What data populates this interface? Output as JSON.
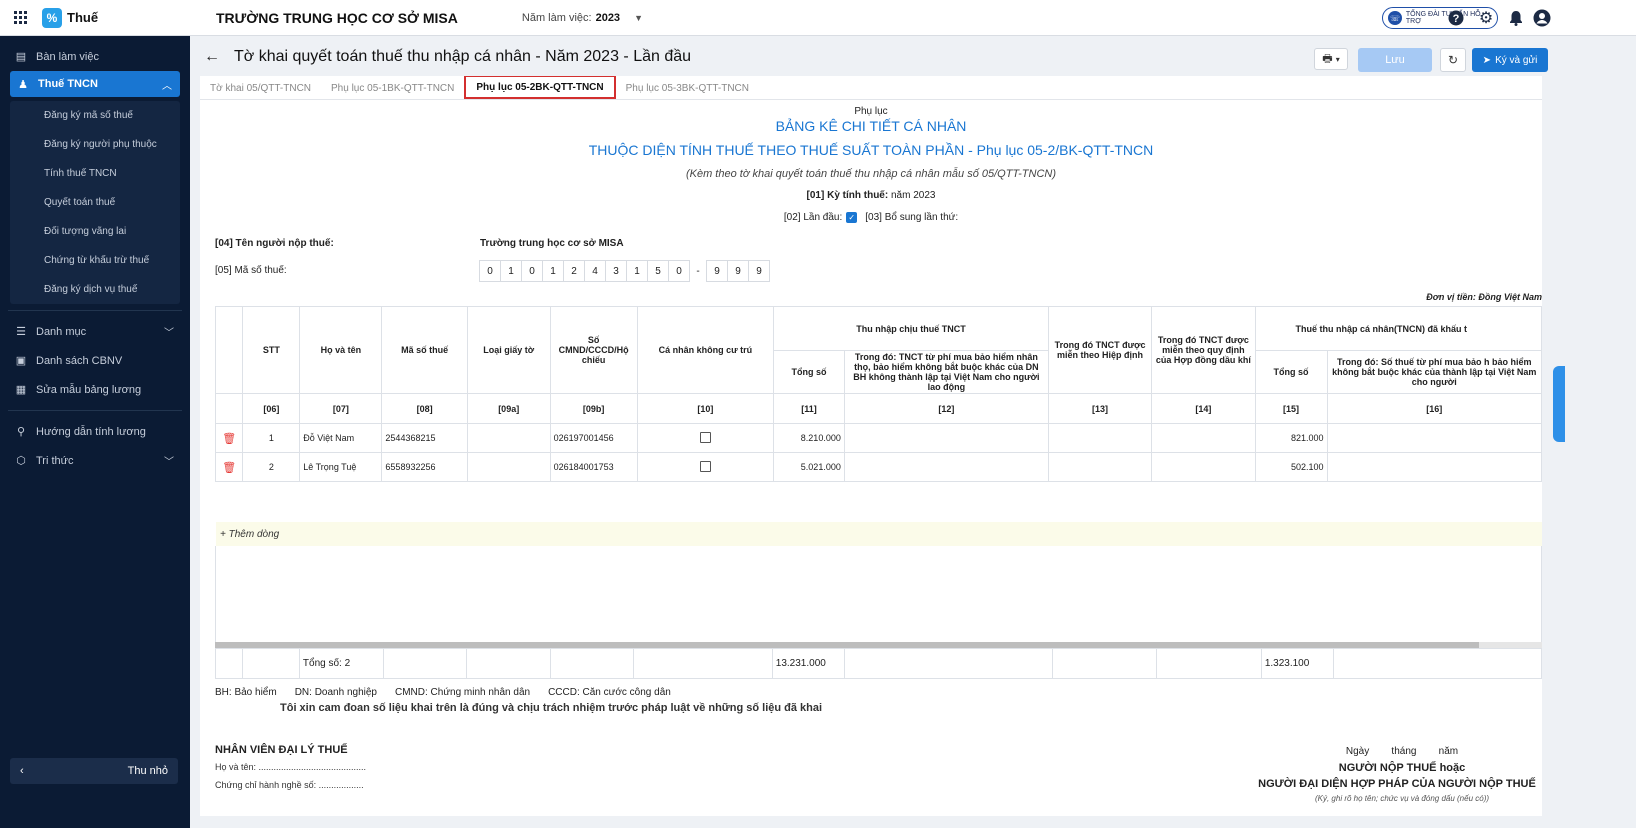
{
  "app": {
    "name": "Thuế",
    "logo_letter": "%",
    "school": "TRƯỜNG TRUNG HỌC CƠ SỞ MISA",
    "year_label": "Năm làm việc:",
    "year_value": "2023",
    "support": "TỔNG ĐÀI TƯ VẤN HỖ TRỢ"
  },
  "sidebar": {
    "workspace": "Bàn làm việc",
    "tncn": "Thuế TNCN",
    "sub": [
      "Đăng ký mã số thuế",
      "Đăng ký người phụ thuộc",
      "Tính thuế TNCN",
      "Quyết toán thuế",
      "Đối tượng vãng lai",
      "Chứng từ khấu trừ thuế",
      "Đăng ký dịch vụ thuế"
    ],
    "catalog": "Danh mục",
    "staff": "Danh sách CBNV",
    "payroll": "Sửa mẫu bảng lương",
    "guide": "Hướng dẫn tính lương",
    "knowledge": "Tri thức",
    "collapse": "Thu nhỏ"
  },
  "page": {
    "title": "Tờ khai quyết toán thuế thu nhập cá nhân - Năm 2023 - Lần đầu",
    "save": "Lưu",
    "sign": "Ký và gửi"
  },
  "tabs": [
    "Tờ khai 05/QTT-TNCN",
    "Phụ lục 05-1BK-QTT-TNCN",
    "Phụ lục 05-2BK-QTT-TNCN",
    "Phụ lục 05-3BK-QTT-TNCN"
  ],
  "form": {
    "sub": "Phụ lục",
    "title1": "BẢNG KÊ CHI TIẾT CÁ NHÂN",
    "title2": "THUỘC DIỆN TÍNH THUẾ THEO THUẾ SUẤT TOÀN PHẦN - Phụ lục 05-2/BK-QTT-TNCN",
    "note": "(Kèm theo tờ khai quyết toán thuế thu nhập cá nhân mẫu số 05/QTT-TNCN)",
    "period_label": "[01] Kỳ tính thuế:",
    "period_value": "năm 2023",
    "first_label": "[02] Lần đầu:",
    "supp_label": "[03] Bổ sung lần thứ:",
    "payer_label": "[04] Tên người nộp thuế:",
    "payer_value": "Trường trung học cơ sở MISA",
    "taxcode_label": "[05] Mã số thuế:",
    "taxcode_digits": [
      "0",
      "1",
      "0",
      "1",
      "2",
      "4",
      "3",
      "1",
      "5",
      "0",
      "-",
      "9",
      "9",
      "9"
    ],
    "unit": "Đơn vị tiền: Đồng Việt Nam"
  },
  "table": {
    "h": {
      "stt": "STT",
      "name": "Họ và tên",
      "mst": "Mã số thuế",
      "doc": "Loại giấy tờ",
      "id": "Số CMND/CCCD/Hộ chiếu",
      "nonres": "Cá nhân không cư trú",
      "income": "Thu nhập chịu thuế TNCT",
      "income_total": "Tổng số",
      "income_ins": "Trong đó: TNCT từ phí mua bảo hiểm nhân thọ, bảo hiểm không bắt buộc khác của DN BH không thành lập tại Việt Nam cho người lao động",
      "exempt_treaty": "Trong đó TNCT được miễn theo Hiệp định",
      "exempt_oil": "Trong đó TNCT được miễn theo quy định của Hợp đồng dầu khí",
      "tax": "Thuế thu nhập cá nhân(TNCN) đã khấu t",
      "tax_total": "Tổng số",
      "tax_ins": "Trong đó: Số thuế từ phí mua bảo h bảo hiểm không bắt buộc khác của thành lập tại Việt Nam cho người"
    },
    "codes": [
      "[06]",
      "[07]",
      "[08]",
      "[09a]",
      "[09b]",
      "[10]",
      "[11]",
      "[12]",
      "[13]",
      "[14]",
      "[15]",
      "[16]"
    ],
    "rows": [
      {
        "stt": "1",
        "name": "Đỗ Việt Nam",
        "mst": "2544368215",
        "id": "026197001456",
        "income": "8.210.000",
        "tax": "821.000"
      },
      {
        "stt": "2",
        "name": "Lê Trọng Tuệ",
        "mst": "6558932256",
        "id": "026184001753",
        "income": "5.021.000",
        "tax": "502.100"
      }
    ],
    "add_row": "+ Thêm dòng",
    "total_label": "Tổng số: 2",
    "total_income": "13.231.000",
    "total_tax": "1.323.100"
  },
  "footer": {
    "legend": [
      "BH: Bảo hiểm",
      "DN: Doanh nghiệp",
      "CMND: Chứng minh nhân dân",
      "CCCD: Căn cước công dân"
    ],
    "commit": "Tôi xin cam đoan số liệu khai trên là đúng và chịu trách nhiệm trước pháp luật về những số liệu đã khai",
    "agent": "NHÂN VIÊN ĐẠI LÝ THUẾ",
    "agent_name": "Họ và tên: ...........................................",
    "agent_cert": "Chứng chỉ hành nghề số: ..................",
    "date": "Ngày        tháng        năm",
    "signer1": "NGƯỜI NỘP THUẾ hoặc",
    "signer2": "NGƯỜI ĐẠI DIỆN HỢP PHÁP CỦA NGƯỜI NỘP THUẾ",
    "signer_note": "(Ký, ghi rõ họ tên; chức vụ và đóng dấu (nếu có))"
  }
}
